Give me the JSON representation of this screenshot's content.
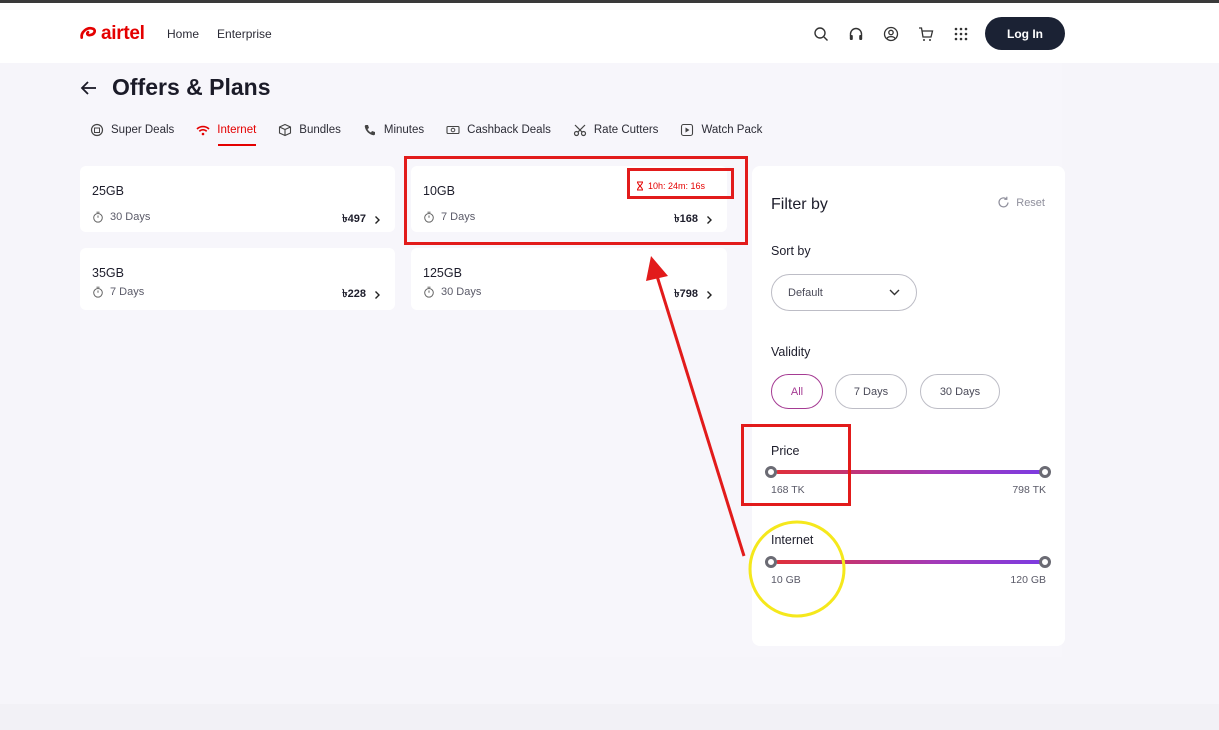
{
  "header": {
    "logo_text": "airtel",
    "nav": [
      "Home",
      "Enterprise"
    ],
    "icons": [
      "search-icon",
      "headset-icon",
      "user-icon",
      "cart-icon",
      "apps-grid-icon"
    ],
    "login_label": "Log In"
  },
  "page": {
    "title": "Offers & Plans",
    "tabs": [
      {
        "label": "Super Deals",
        "icon": "gift-box-icon"
      },
      {
        "label": "Internet",
        "icon": "wifi-icon",
        "active": true
      },
      {
        "label": "Bundles",
        "icon": "package-icon"
      },
      {
        "label": "Minutes",
        "icon": "phone-icon"
      },
      {
        "label": "Cashback Deals",
        "icon": "cash-icon"
      },
      {
        "label": "Rate Cutters",
        "icon": "scissors-icon"
      },
      {
        "label": "Watch Pack",
        "icon": "play-icon"
      }
    ]
  },
  "plans": [
    {
      "gb": "25GB",
      "days": "30 Days",
      "price": "৳497"
    },
    {
      "gb": "10GB",
      "days": "7 Days",
      "price": "৳168",
      "timer": "10h: 24m: 16s"
    },
    {
      "gb": "35GB",
      "days": "7 Days",
      "price": "৳228"
    },
    {
      "gb": "125GB",
      "days": "30 Days",
      "price": "৳798"
    }
  ],
  "filter": {
    "title": "Filter by",
    "reset_label": "Reset",
    "sort_label": "Sort by",
    "sort_value": "Default",
    "validity_label": "Validity",
    "validity_options": [
      "All",
      "7 Days",
      "30 Days"
    ],
    "validity_selected": "All",
    "price_label": "Price",
    "price_min": "168 TK",
    "price_max": "798 TK",
    "internet_label": "Internet",
    "internet_min": "10 GB",
    "internet_max": "120 GB"
  },
  "colors": {
    "brand_red": "#e40000",
    "accent_purple": "#a53b93",
    "annotation_red": "#e21b1b",
    "annotation_yellow": "#f5e81c"
  }
}
